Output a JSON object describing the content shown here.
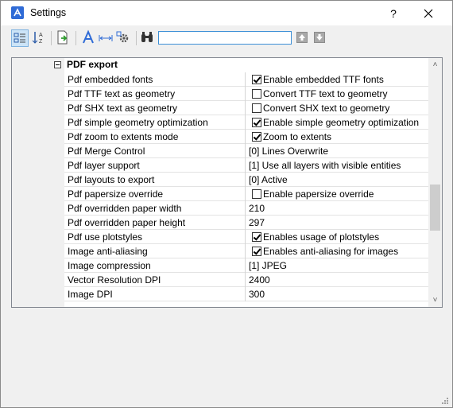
{
  "window": {
    "title": "Settings",
    "help_label": "?",
    "icon": "app-logo-icon"
  },
  "toolbar": {
    "buttons": [
      {
        "name": "categorized-view-icon",
        "active": true
      },
      {
        "name": "alphabetical-sort-icon",
        "active": false
      },
      {
        "name": "export-icon",
        "active": false
      },
      {
        "name": "app-settings-icon",
        "active": false
      },
      {
        "name": "dimension-icon",
        "active": false
      },
      {
        "name": "gear-settings-icon",
        "active": false
      },
      {
        "name": "binoculars-search-icon",
        "active": false
      }
    ],
    "search_value": "",
    "nav": [
      "arrow-up-icon",
      "arrow-down-icon"
    ]
  },
  "section": {
    "title": "PDF export",
    "expanded": true
  },
  "rows": [
    {
      "name": "Pdf embedded fonts",
      "checkbox": true,
      "checked": true,
      "value": "Enable embedded TTF fonts"
    },
    {
      "name": "Pdf TTF text as geometry",
      "checkbox": true,
      "checked": false,
      "value": "Convert TTF text to geometry"
    },
    {
      "name": "Pdf SHX text as geometry",
      "checkbox": true,
      "checked": false,
      "value": "Convert SHX text to geometry"
    },
    {
      "name": "Pdf simple geometry optimization",
      "checkbox": true,
      "checked": true,
      "value": "Enable simple geometry optimization"
    },
    {
      "name": "Pdf zoom to extents mode",
      "checkbox": true,
      "checked": true,
      "value": "Zoom to extents"
    },
    {
      "name": "Pdf Merge Control",
      "checkbox": false,
      "checked": false,
      "value": "[0] Lines Overwrite"
    },
    {
      "name": "Pdf layer support",
      "checkbox": false,
      "checked": false,
      "value": "[1] Use all layers with visible entities"
    },
    {
      "name": "Pdf layouts to export",
      "checkbox": false,
      "checked": false,
      "value": "[0] Active"
    },
    {
      "name": "Pdf papersize override",
      "checkbox": true,
      "checked": false,
      "value": "Enable papersize override"
    },
    {
      "name": "Pdf overridden paper width",
      "checkbox": false,
      "checked": false,
      "value": "210"
    },
    {
      "name": "Pdf overridden paper height",
      "checkbox": false,
      "checked": false,
      "value": "297"
    },
    {
      "name": "Pdf use plotstyles",
      "checkbox": true,
      "checked": true,
      "value": "Enables usage of plotstyles"
    },
    {
      "name": "Image anti-aliasing",
      "checkbox": true,
      "checked": true,
      "value": "Enables anti-aliasing for images"
    },
    {
      "name": "Image compression",
      "checkbox": false,
      "checked": false,
      "value": "[1] JPEG"
    },
    {
      "name": "Vector Resolution DPI",
      "checkbox": false,
      "checked": false,
      "value": "2400"
    },
    {
      "name": "Image DPI",
      "checkbox": false,
      "checked": false,
      "value": "300"
    }
  ],
  "scrollbar": {
    "up_glyph": "˄",
    "down_glyph": "˅"
  },
  "colors": {
    "accent": "#3c8fd6",
    "app_icon": "#2f6bd6"
  }
}
